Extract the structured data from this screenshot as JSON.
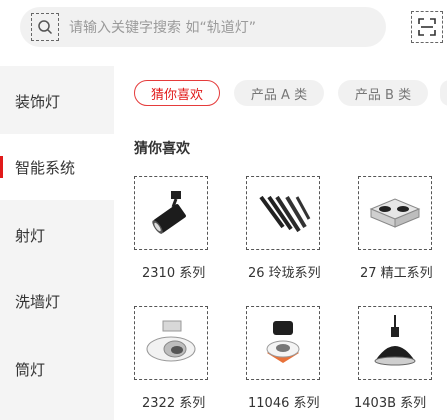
{
  "search": {
    "placeholder": "请输入关键字搜索 如“轨道灯”"
  },
  "sidebar": {
    "items": [
      {
        "label": "装饰灯"
      },
      {
        "label": "智能系统"
      },
      {
        "label": "射灯"
      },
      {
        "label": "洗墙灯"
      },
      {
        "label": "筒灯"
      }
    ],
    "active_index": 1
  },
  "tabs": [
    {
      "label": "猜你喜欢",
      "active": true
    },
    {
      "label": "产品 A 类",
      "active": false
    },
    {
      "label": "产品 B 类",
      "active": false
    }
  ],
  "section": {
    "title": "猜你喜欢"
  },
  "products": [
    {
      "name": "2310 系列",
      "icon": "track-spotlight-icon"
    },
    {
      "name": "26 玲珑系列",
      "icon": "linear-lights-icon"
    },
    {
      "name": "27 精工系列",
      "icon": "grille-downlight-icon"
    },
    {
      "name": "2322 系列",
      "icon": "recessed-spotlight-icon"
    },
    {
      "name": "11046 系列",
      "icon": "cylinder-downlight-icon"
    },
    {
      "name": "1403B 系列",
      "icon": "pendant-lamp-icon"
    }
  ],
  "colors": {
    "accent": "#e11a1a",
    "sidebar_bg": "#f4f4f4",
    "search_bg": "#f1f1f1"
  }
}
